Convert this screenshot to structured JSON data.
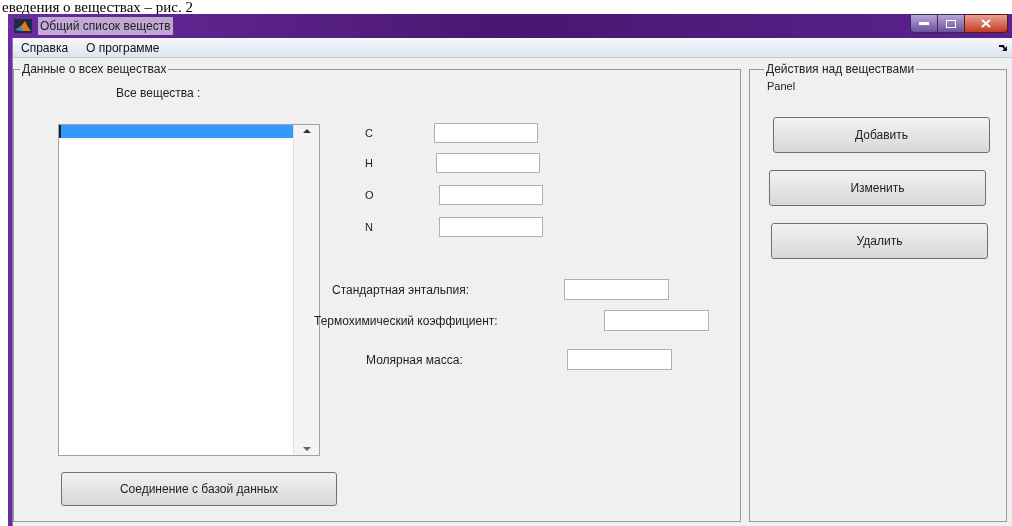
{
  "document_caption": "еведения о веществах – рис. 2",
  "window": {
    "title": "Общий список веществ"
  },
  "menu": [
    {
      "label": "Справка"
    },
    {
      "label": "О программе"
    }
  ],
  "data_panel": {
    "title": "Данные о всех веществах",
    "list_label": "Все вещества :",
    "list_rows": [
      {
        "selected": true
      }
    ],
    "element_fields": [
      {
        "label": "C"
      },
      {
        "label": "H"
      },
      {
        "label": "O"
      },
      {
        "label": "N"
      }
    ],
    "property_fields": [
      {
        "label": "Стандартная энтальпия:"
      },
      {
        "label": "Термохимический коэффициент:"
      },
      {
        "label": "Молярная масса:"
      }
    ],
    "connect_button": "Соединение с базой данных"
  },
  "actions_panel": {
    "title": "Действия над веществами",
    "subtitle": "Panel",
    "buttons": [
      "Добавить",
      "Изменить",
      "Удалить"
    ]
  }
}
